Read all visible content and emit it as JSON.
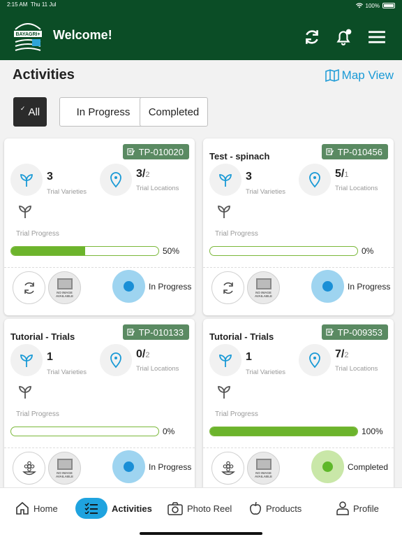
{
  "status_bar": {
    "time": "2:15 AM",
    "date": "Thu 11 Jul",
    "battery": "100%"
  },
  "header": {
    "logo_text": "BAYAGRI+",
    "title": "Welcome!"
  },
  "page": {
    "title": "Activities",
    "map_view_label": "Map View"
  },
  "filters": [
    {
      "label": "All",
      "selected": true
    },
    {
      "label": "In Progress",
      "selected": false
    },
    {
      "label": "Completed",
      "selected": false
    }
  ],
  "labels": {
    "trial_varieties": "Trial Varieties",
    "trial_locations": "Trial Locations",
    "trial_progress": "Trial Progress",
    "no_image": "NO IMAGE AVAILABLE"
  },
  "cards": [
    {
      "title": "",
      "code": "TP-010020",
      "varieties": "3",
      "locations": "3/",
      "locations_total": "2",
      "progress_pct": "50%",
      "progress": 0.5,
      "status": "In Progress",
      "status_color": "#1a8fd6",
      "status_bg": "#9ed4f0",
      "thumb_icon": "sync-icon"
    },
    {
      "title": "Test - spinach",
      "code": "TP-010456",
      "varieties": "3",
      "locations": "5/",
      "locations_total": "1",
      "progress_pct": "0%",
      "progress": 0,
      "status": "In Progress",
      "status_color": "#1a8fd6",
      "status_bg": "#9ed4f0",
      "thumb_icon": "sync-icon"
    },
    {
      "title": "Tutorial - Trials",
      "code": "TP-010133",
      "varieties": "1",
      "locations": "0/",
      "locations_total": "2",
      "progress_pct": "0%",
      "progress": 0,
      "status": "In Progress",
      "status_color": "#1a8fd6",
      "status_bg": "#9ed4f0",
      "thumb_icon": "flower-icon"
    },
    {
      "title": "Tutorial - Trials",
      "code": "TP-009353",
      "varieties": "1",
      "locations": "7/",
      "locations_total": "2",
      "progress_pct": "100%",
      "progress": 1,
      "status": "Completed",
      "status_color": "#5fb82a",
      "status_bg": "#c9e7a8",
      "thumb_icon": "flower-icon"
    }
  ],
  "nav": [
    {
      "label": "Home",
      "icon": "home-icon"
    },
    {
      "label": "Activities",
      "icon": "checklist-icon",
      "active": true
    },
    {
      "label": "Photo Reel",
      "icon": "camera-icon"
    },
    {
      "label": "Products",
      "icon": "apple-icon"
    },
    {
      "label": "Profile",
      "icon": "person-icon"
    }
  ]
}
